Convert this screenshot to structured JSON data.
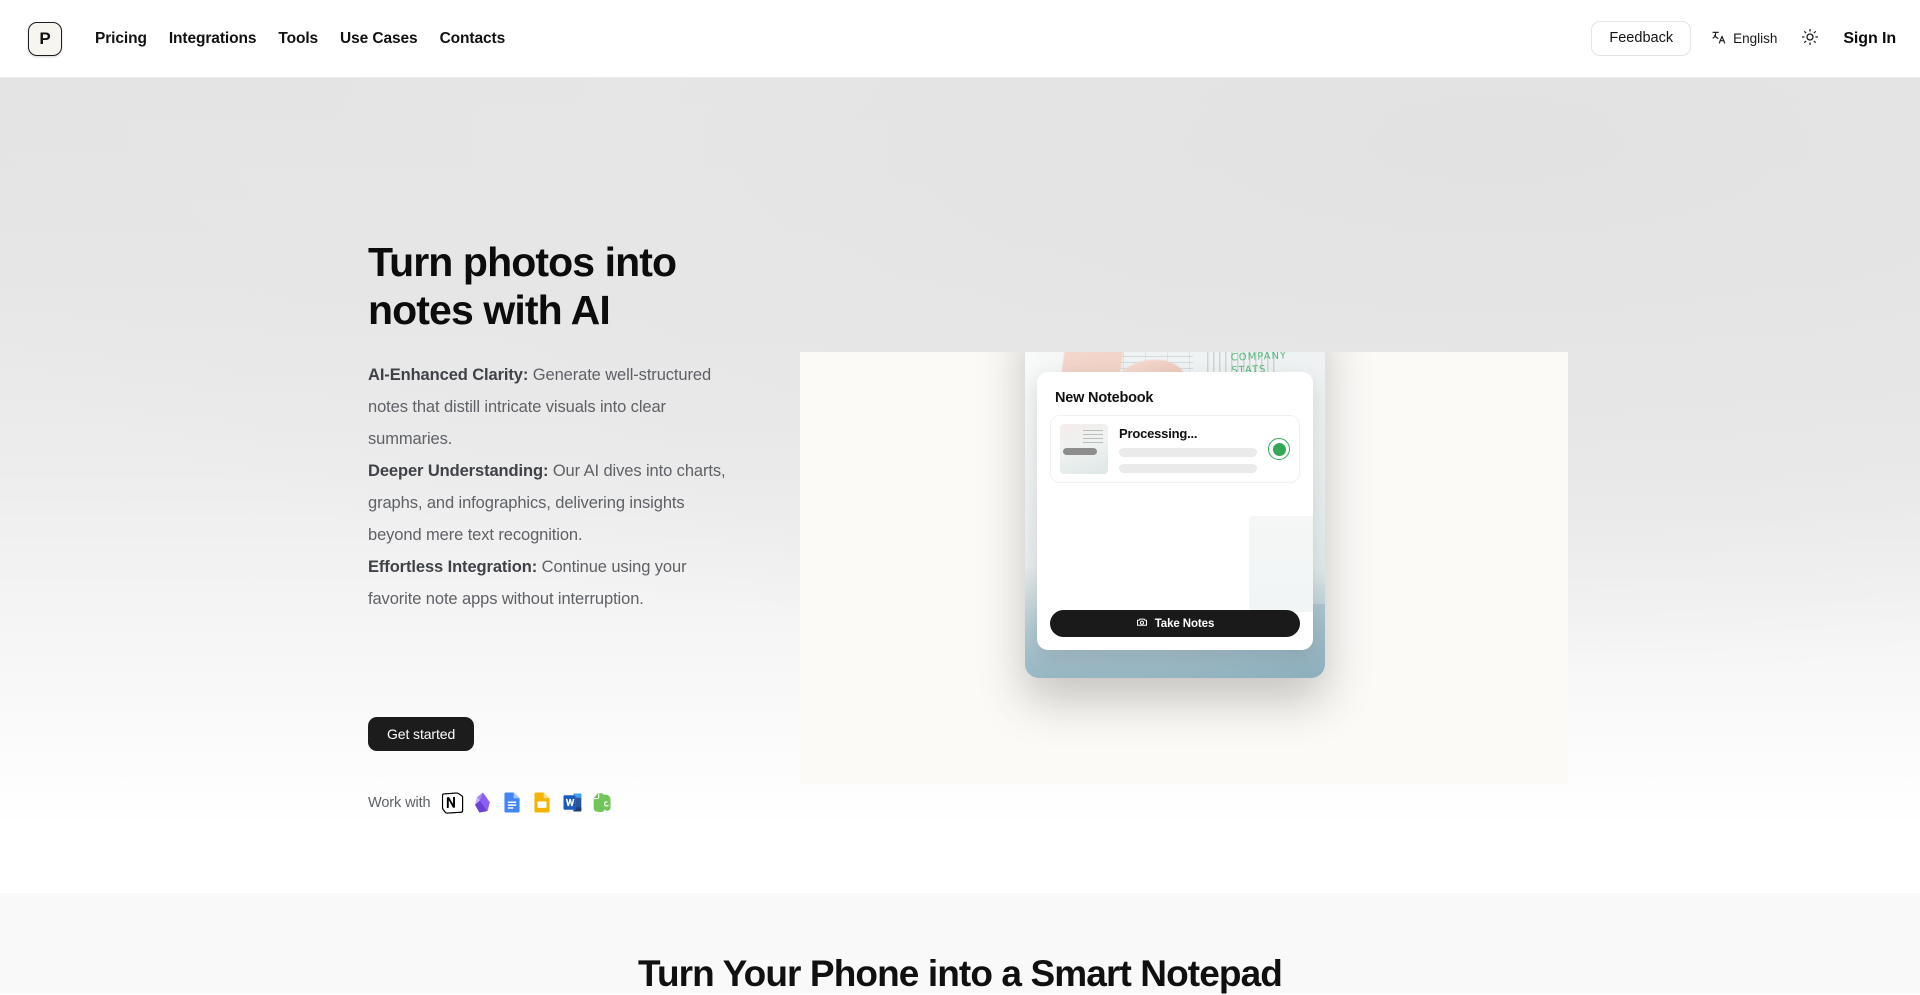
{
  "header": {
    "logo_letter": "P",
    "nav": [
      {
        "label": "Pricing",
        "name": "nav-pricing"
      },
      {
        "label": "Integrations",
        "name": "nav-integrations"
      },
      {
        "label": "Tools",
        "name": "nav-tools"
      },
      {
        "label": "Use Cases",
        "name": "nav-use-cases"
      },
      {
        "label": "Contacts",
        "name": "nav-contacts"
      }
    ],
    "feedback_label": "Feedback",
    "language_label": "English",
    "language_icon": "translate-icon",
    "theme_icon": "sun-icon",
    "signin_label": "Sign In"
  },
  "hero": {
    "title": "Turn photos into\nnotes with AI",
    "features": [
      {
        "term": "AI-Enhanced Clarity:",
        "text": " Generate well-structured notes that distill intricate visuals into clear summaries."
      },
      {
        "term": "Deeper Understanding:",
        "text": " Our AI dives into charts, graphs, and infographics, delivering insights beyond mere text recognition."
      },
      {
        "term": "Effortless Integration:",
        "text": " Continue using your favorite note apps without interruption."
      }
    ],
    "cta_label": "Get started",
    "work_with_label": "Work with",
    "integrations": [
      {
        "name": "notion-icon",
        "label": "Notion"
      },
      {
        "name": "obsidian-icon",
        "label": "Obsidian"
      },
      {
        "name": "google-docs-icon",
        "label": "Google Docs"
      },
      {
        "name": "google-slides-icon",
        "label": "Google Slides"
      },
      {
        "name": "microsoft-word-icon",
        "label": "Microsoft Word"
      },
      {
        "name": "evernote-icon",
        "label": "Evernote"
      }
    ]
  },
  "app_preview": {
    "card_title": "New Notebook",
    "processing_label": "Processing...",
    "status_color": "#34a853",
    "take_notes_label": "Take Notes",
    "camera_icon": "camera-icon",
    "photo_caption_text": "COMPANY STATS"
  },
  "section2": {
    "title": "Turn Your Phone into a Smart Notepad"
  },
  "colors": {
    "accent_dark": "#1c1c1c",
    "status_green": "#34a853",
    "hero_panel": "#fbfaf7",
    "section2_bg": "#f9f9f9"
  }
}
